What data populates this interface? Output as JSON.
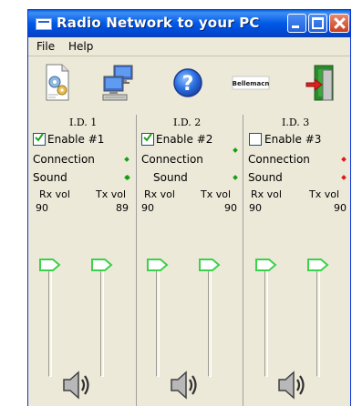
{
  "window": {
    "title": "Radio Network to your PC"
  },
  "menu": [
    "File",
    "Help"
  ],
  "toolbar": {
    "icons": [
      "settings-document-icon",
      "network-computers-icon",
      "help-icon",
      "logo-icon",
      "exit-door-icon"
    ],
    "logo_text": "Bellemacn"
  },
  "labels": {
    "connection": "Connection",
    "sound": "Sound",
    "rx_vol": "Rx vol",
    "tx_vol": "Tx vol"
  },
  "colors": {
    "status_on": "#12a012",
    "status_off": "#e11818",
    "slider_thumb": "#3bd14b"
  },
  "channels": [
    {
      "id": "I.D. 1",
      "enable_label": "Enable  #1",
      "enabled": true,
      "connection_ok": true,
      "sound_ok": true,
      "rx_vol": "90",
      "tx_vol": "89"
    },
    {
      "id": "I.D. 2",
      "enable_label": "Enable  #2",
      "enabled": true,
      "connection_ok": true,
      "sound_ok": true,
      "rx_vol": "90",
      "tx_vol": "90"
    },
    {
      "id": "I.D. 3",
      "enable_label": "Enable  #3",
      "enabled": false,
      "connection_ok": false,
      "sound_ok": false,
      "rx_vol": "90",
      "tx_vol": "90"
    }
  ]
}
